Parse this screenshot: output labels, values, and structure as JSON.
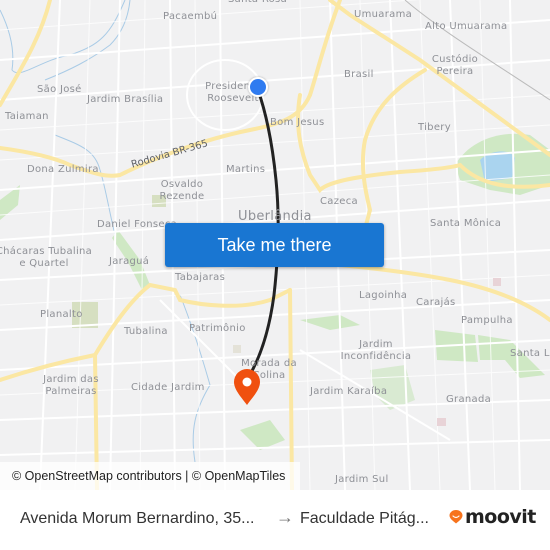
{
  "map": {
    "labels": [
      {
        "text": "Santa Rosa",
        "kind": "district"
      },
      {
        "text": "Pacaembú",
        "kind": "district"
      },
      {
        "text": "Umuarama",
        "kind": "district"
      },
      {
        "text": "Alto Umuarama",
        "kind": "district"
      },
      {
        "text": "São José",
        "kind": "district"
      },
      {
        "text": "Jardim Brasília",
        "kind": "district"
      },
      {
        "text": "Presidente Roosevelt",
        "kind": "district"
      },
      {
        "text": "Brasil",
        "kind": "district"
      },
      {
        "text": "Custódio Pereira",
        "kind": "district"
      },
      {
        "text": "Taiaman",
        "kind": "district"
      },
      {
        "text": "Bom Jesus",
        "kind": "district"
      },
      {
        "text": "Tibery",
        "kind": "district"
      },
      {
        "text": "Dona Zulmira",
        "kind": "district"
      },
      {
        "text": "Martins",
        "kind": "district"
      },
      {
        "text": "Osvaldo Rezende",
        "kind": "district"
      },
      {
        "text": "Cazeca",
        "kind": "district"
      },
      {
        "text": "Uberlândia",
        "kind": "city"
      },
      {
        "text": "Daniel Fonseca",
        "kind": "district"
      },
      {
        "text": "Santa Mônica",
        "kind": "district"
      },
      {
        "text": "Chácaras Tubalina e Quartel",
        "kind": "district"
      },
      {
        "text": "Jaraguá",
        "kind": "district"
      },
      {
        "text": "Tabajaras",
        "kind": "district"
      },
      {
        "text": "Lagoinha",
        "kind": "district"
      },
      {
        "text": "Carajás",
        "kind": "district"
      },
      {
        "text": "Planalto",
        "kind": "district"
      },
      {
        "text": "Tubalina",
        "kind": "district"
      },
      {
        "text": "Patrimônio",
        "kind": "district"
      },
      {
        "text": "Pampulha",
        "kind": "district"
      },
      {
        "text": "Jardim Inconfidência",
        "kind": "district"
      },
      {
        "text": "Morada da Colina",
        "kind": "district"
      },
      {
        "text": "Santa Luzia",
        "kind": "district"
      },
      {
        "text": "Jardim das Palmeiras",
        "kind": "district"
      },
      {
        "text": "Cidade Jardim",
        "kind": "district"
      },
      {
        "text": "Jardim Karaíba",
        "kind": "district"
      },
      {
        "text": "Granada",
        "kind": "district"
      },
      {
        "text": "Jardim Sul",
        "kind": "district"
      }
    ],
    "road_label": "Rodovia BR-365",
    "origin_marker_color": "#2f7bf0",
    "destination_marker_color": "#f0500f",
    "route_color": "#222222",
    "cta_label": "Take me there",
    "cta_color": "#1976d2",
    "attribution": "© OpenStreetMap contributors | © OpenMapTiles"
  },
  "footer": {
    "from": "Avenida Morum Bernardino, 35...",
    "arrow": "→",
    "to": "Faculdade Pitág...",
    "brand": "moovit",
    "brand_color": "#f7731c"
  }
}
